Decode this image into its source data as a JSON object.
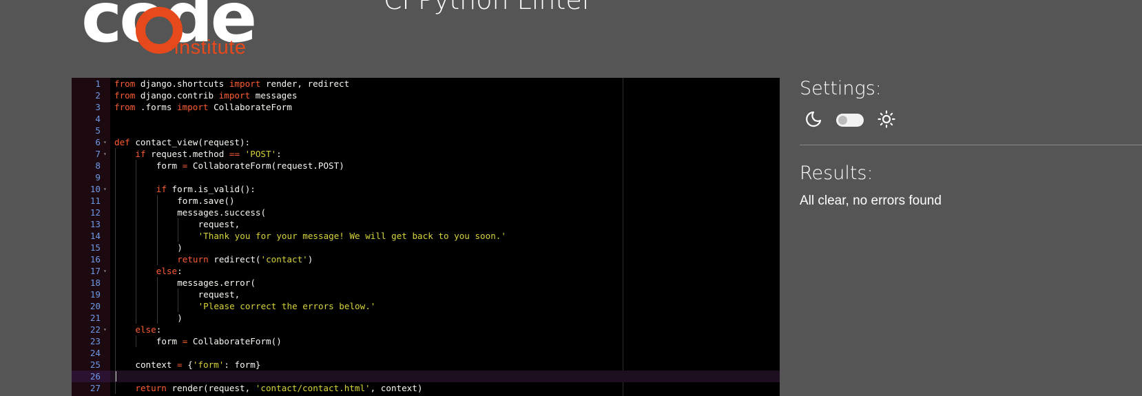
{
  "header": {
    "logo_word": "code",
    "logo_sub": "institute",
    "title": "CI Python Linter"
  },
  "editor": {
    "lines": [
      {
        "n": "1",
        "fold": false,
        "indent": 0,
        "tokens": [
          {
            "t": "kw",
            "v": "from"
          },
          {
            "t": "tx",
            "v": " django.shortcuts "
          },
          {
            "t": "kw",
            "v": "import"
          },
          {
            "t": "tx",
            "v": " render, redirect"
          }
        ]
      },
      {
        "n": "2",
        "fold": false,
        "indent": 0,
        "tokens": [
          {
            "t": "kw",
            "v": "from"
          },
          {
            "t": "tx",
            "v": " django.contrib "
          },
          {
            "t": "kw",
            "v": "import"
          },
          {
            "t": "tx",
            "v": " messages"
          }
        ]
      },
      {
        "n": "3",
        "fold": false,
        "indent": 0,
        "tokens": [
          {
            "t": "kw",
            "v": "from"
          },
          {
            "t": "tx",
            "v": " .forms "
          },
          {
            "t": "kw",
            "v": "import"
          },
          {
            "t": "tx",
            "v": " CollaborateForm"
          }
        ]
      },
      {
        "n": "4",
        "fold": false,
        "indent": 0,
        "tokens": []
      },
      {
        "n": "5",
        "fold": false,
        "indent": 0,
        "tokens": []
      },
      {
        "n": "6",
        "fold": true,
        "indent": 0,
        "tokens": [
          {
            "t": "kw",
            "v": "def"
          },
          {
            "t": "tx",
            "v": " contact_view(request):"
          }
        ]
      },
      {
        "n": "7",
        "fold": true,
        "indent": 1,
        "tokens": [
          {
            "t": "kw",
            "v": "if"
          },
          {
            "t": "tx",
            "v": " request.method "
          },
          {
            "t": "op",
            "v": "=="
          },
          {
            "t": "tx",
            "v": " "
          },
          {
            "t": "st",
            "v": "'POST'"
          },
          {
            "t": "tx",
            "v": ":"
          }
        ]
      },
      {
        "n": "8",
        "fold": false,
        "indent": 2,
        "tokens": [
          {
            "t": "tx",
            "v": "form "
          },
          {
            "t": "op",
            "v": "="
          },
          {
            "t": "tx",
            "v": " CollaborateForm(request.POST)"
          }
        ]
      },
      {
        "n": "9",
        "fold": false,
        "indent": 2,
        "tokens": []
      },
      {
        "n": "10",
        "fold": true,
        "indent": 2,
        "tokens": [
          {
            "t": "kw",
            "v": "if"
          },
          {
            "t": "tx",
            "v": " form.is_valid():"
          }
        ]
      },
      {
        "n": "11",
        "fold": false,
        "indent": 3,
        "tokens": [
          {
            "t": "tx",
            "v": "form.save()"
          }
        ]
      },
      {
        "n": "12",
        "fold": false,
        "indent": 3,
        "tokens": [
          {
            "t": "tx",
            "v": "messages.success("
          }
        ]
      },
      {
        "n": "13",
        "fold": false,
        "indent": 4,
        "tokens": [
          {
            "t": "tx",
            "v": "request,"
          }
        ]
      },
      {
        "n": "14",
        "fold": false,
        "indent": 4,
        "tokens": [
          {
            "t": "st",
            "v": "'Thank you for your message! We will get back to you soon.'"
          }
        ]
      },
      {
        "n": "15",
        "fold": false,
        "indent": 3,
        "tokens": [
          {
            "t": "tx",
            "v": ")"
          }
        ]
      },
      {
        "n": "16",
        "fold": false,
        "indent": 3,
        "tokens": [
          {
            "t": "kw",
            "v": "return"
          },
          {
            "t": "tx",
            "v": " redirect("
          },
          {
            "t": "st",
            "v": "'contact'"
          },
          {
            "t": "tx",
            "v": ")"
          }
        ]
      },
      {
        "n": "17",
        "fold": true,
        "indent": 2,
        "tokens": [
          {
            "t": "kw",
            "v": "else"
          },
          {
            "t": "tx",
            "v": ":"
          }
        ]
      },
      {
        "n": "18",
        "fold": false,
        "indent": 3,
        "tokens": [
          {
            "t": "tx",
            "v": "messages.error("
          }
        ]
      },
      {
        "n": "19",
        "fold": false,
        "indent": 4,
        "tokens": [
          {
            "t": "tx",
            "v": "request,"
          }
        ]
      },
      {
        "n": "20",
        "fold": false,
        "indent": 4,
        "tokens": [
          {
            "t": "st",
            "v": "'Please correct the errors below.'"
          }
        ]
      },
      {
        "n": "21",
        "fold": false,
        "indent": 3,
        "tokens": [
          {
            "t": "tx",
            "v": ")"
          }
        ]
      },
      {
        "n": "22",
        "fold": true,
        "indent": 1,
        "tokens": [
          {
            "t": "kw",
            "v": "else"
          },
          {
            "t": "tx",
            "v": ":"
          }
        ]
      },
      {
        "n": "23",
        "fold": false,
        "indent": 2,
        "tokens": [
          {
            "t": "tx",
            "v": "form "
          },
          {
            "t": "op",
            "v": "="
          },
          {
            "t": "tx",
            "v": " CollaborateForm()"
          }
        ]
      },
      {
        "n": "24",
        "fold": false,
        "indent": 1,
        "tokens": []
      },
      {
        "n": "25",
        "fold": false,
        "indent": 1,
        "tokens": [
          {
            "t": "tx",
            "v": "context "
          },
          {
            "t": "op",
            "v": "="
          },
          {
            "t": "tx",
            "v": " {"
          },
          {
            "t": "st",
            "v": "'form'"
          },
          {
            "t": "tx",
            "v": ": form}"
          }
        ]
      },
      {
        "n": "26",
        "fold": false,
        "indent": 1,
        "active": true,
        "tokens": []
      },
      {
        "n": "27",
        "fold": false,
        "indent": 1,
        "tokens": [
          {
            "t": "kw",
            "v": "return"
          },
          {
            "t": "tx",
            "v": " render(request, "
          },
          {
            "t": "st",
            "v": "'contact/contact.html'"
          },
          {
            "t": "tx",
            "v": ", context)"
          }
        ]
      }
    ]
  },
  "settings": {
    "title": "Settings:",
    "dark_icon": "moon-icon",
    "light_icon": "sun-icon",
    "theme_toggle_on": false
  },
  "results": {
    "title": "Results:",
    "message": "All clear, no errors found"
  },
  "colors": {
    "background": "#555555",
    "accent": "#e6491c",
    "keyword": "#ff5c33",
    "string": "#d7d43a",
    "line_number": "#6f9ae8"
  }
}
